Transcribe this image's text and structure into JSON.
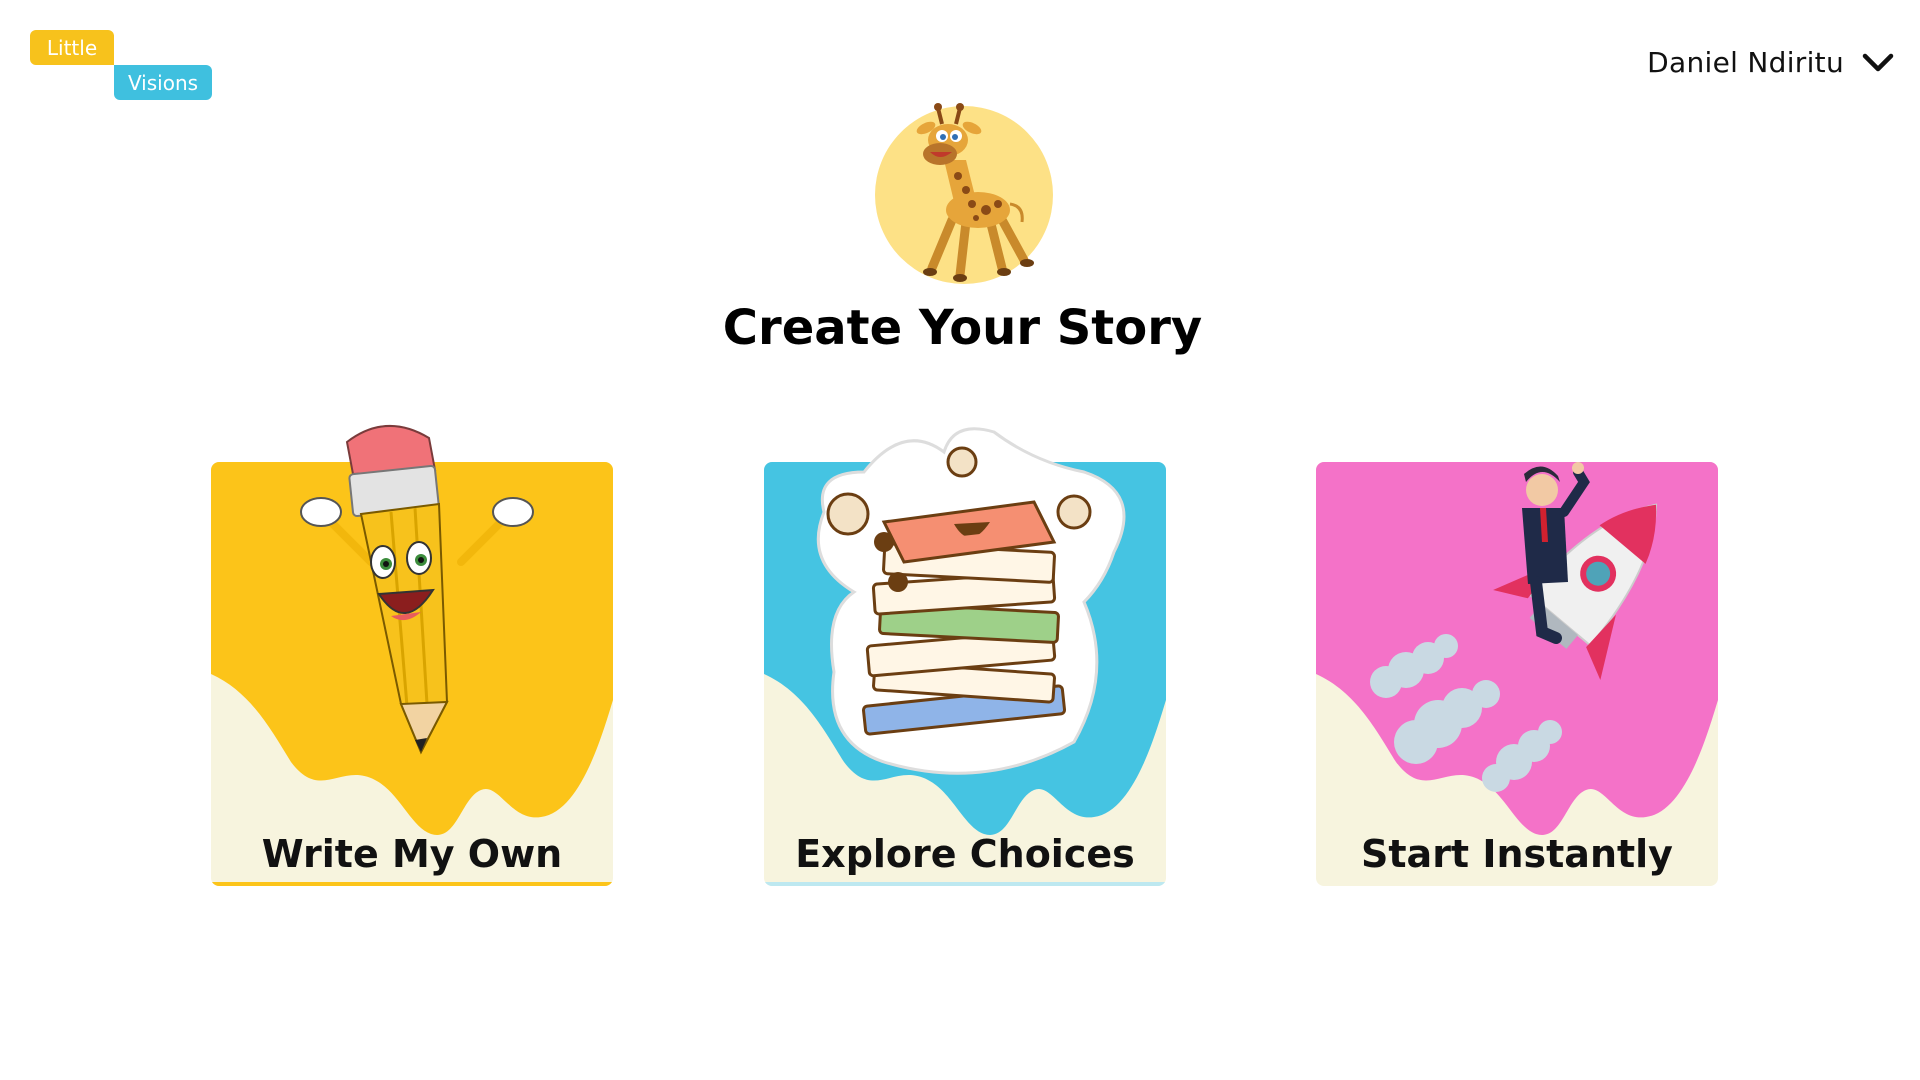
{
  "app": {
    "logo": {
      "line1": "Little",
      "line2": "Visions"
    },
    "user": {
      "name": "Daniel Ndiritu",
      "menu_icon": "chevron-down-icon"
    }
  },
  "main": {
    "mascot_icon": "giraffe-mascot",
    "title": "Create Your Story",
    "options": [
      {
        "label": "Write My Own",
        "icon": "pencil-character",
        "color": "#FCC419"
      },
      {
        "label": "Explore Choices",
        "icon": "book-stack-character",
        "color": "#45C4E2"
      },
      {
        "label": "Start Instantly",
        "icon": "rocket-rider",
        "color": "#F472C8"
      }
    ]
  },
  "colors": {
    "logo_yellow": "#F7C21C",
    "logo_blue": "#3FC0DF",
    "cream": "#F7F4DE",
    "mascot_circle": "#FDE186"
  }
}
